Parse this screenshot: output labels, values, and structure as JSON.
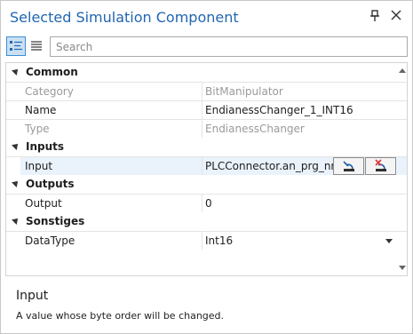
{
  "window": {
    "title": "Selected Simulation Component",
    "pin_glyph": "⭳",
    "close_glyph": "✕"
  },
  "toolbar": {
    "search_placeholder": "Search",
    "view_mode": "categorized"
  },
  "grid": {
    "categories": [
      {
        "label": "Common",
        "properties": [
          {
            "name": "Category",
            "value": "BitManipulator",
            "readonly": true
          },
          {
            "name": "Name",
            "value": "EndianessChanger_1_INT16",
            "readonly": false
          },
          {
            "name": "Type",
            "value": "EndianessChanger",
            "readonly": true
          }
        ]
      },
      {
        "label": "Inputs",
        "properties": [
          {
            "name": "Input",
            "value": "PLCConnector.an_prg_nr",
            "readonly": false,
            "selected": true
          }
        ]
      },
      {
        "label": "Outputs",
        "properties": [
          {
            "name": "Output",
            "value": "0",
            "readonly": false
          }
        ]
      },
      {
        "label": "Sonstiges",
        "properties": [
          {
            "name": "DataType",
            "value": "Int16",
            "readonly": false
          }
        ]
      }
    ]
  },
  "description": {
    "title": "Input",
    "text": "A value whose byte order will be changed."
  },
  "colors": {
    "title": "#2167b0",
    "selection": "#eaf2fb",
    "toolbar_active": "#c9dff3",
    "readonly_text": "#9a9a9a"
  }
}
